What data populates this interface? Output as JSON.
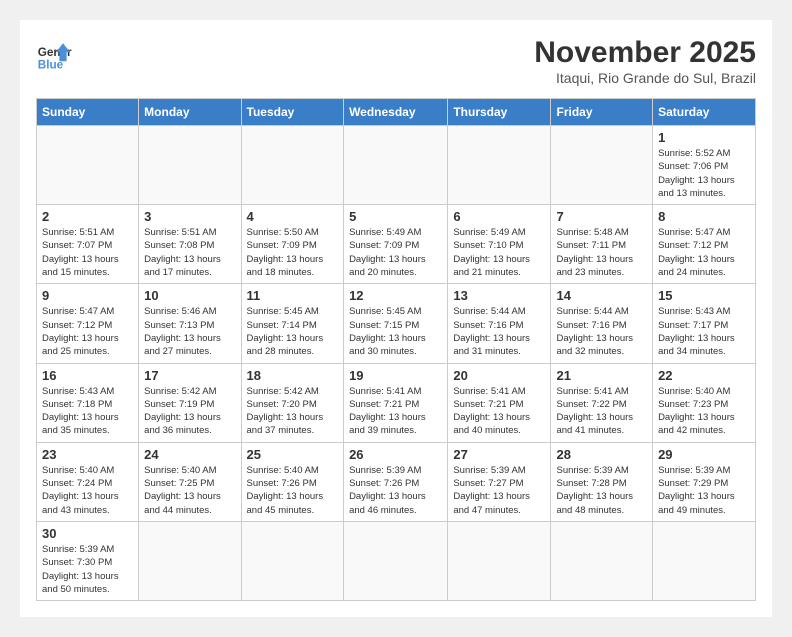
{
  "header": {
    "logo_general": "General",
    "logo_blue": "Blue",
    "month_title": "November 2025",
    "location": "Itaqui, Rio Grande do Sul, Brazil"
  },
  "weekdays": [
    "Sunday",
    "Monday",
    "Tuesday",
    "Wednesday",
    "Thursday",
    "Friday",
    "Saturday"
  ],
  "days": {
    "1": {
      "sunrise": "5:52 AM",
      "sunset": "7:06 PM",
      "daylight": "13 hours and 13 minutes."
    },
    "2": {
      "sunrise": "5:51 AM",
      "sunset": "7:07 PM",
      "daylight": "13 hours and 15 minutes."
    },
    "3": {
      "sunrise": "5:51 AM",
      "sunset": "7:08 PM",
      "daylight": "13 hours and 17 minutes."
    },
    "4": {
      "sunrise": "5:50 AM",
      "sunset": "7:09 PM",
      "daylight": "13 hours and 18 minutes."
    },
    "5": {
      "sunrise": "5:49 AM",
      "sunset": "7:09 PM",
      "daylight": "13 hours and 20 minutes."
    },
    "6": {
      "sunrise": "5:49 AM",
      "sunset": "7:10 PM",
      "daylight": "13 hours and 21 minutes."
    },
    "7": {
      "sunrise": "5:48 AM",
      "sunset": "7:11 PM",
      "daylight": "13 hours and 23 minutes."
    },
    "8": {
      "sunrise": "5:47 AM",
      "sunset": "7:12 PM",
      "daylight": "13 hours and 24 minutes."
    },
    "9": {
      "sunrise": "5:47 AM",
      "sunset": "7:12 PM",
      "daylight": "13 hours and 25 minutes."
    },
    "10": {
      "sunrise": "5:46 AM",
      "sunset": "7:13 PM",
      "daylight": "13 hours and 27 minutes."
    },
    "11": {
      "sunrise": "5:45 AM",
      "sunset": "7:14 PM",
      "daylight": "13 hours and 28 minutes."
    },
    "12": {
      "sunrise": "5:45 AM",
      "sunset": "7:15 PM",
      "daylight": "13 hours and 30 minutes."
    },
    "13": {
      "sunrise": "5:44 AM",
      "sunset": "7:16 PM",
      "daylight": "13 hours and 31 minutes."
    },
    "14": {
      "sunrise": "5:44 AM",
      "sunset": "7:16 PM",
      "daylight": "13 hours and 32 minutes."
    },
    "15": {
      "sunrise": "5:43 AM",
      "sunset": "7:17 PM",
      "daylight": "13 hours and 34 minutes."
    },
    "16": {
      "sunrise": "5:43 AM",
      "sunset": "7:18 PM",
      "daylight": "13 hours and 35 minutes."
    },
    "17": {
      "sunrise": "5:42 AM",
      "sunset": "7:19 PM",
      "daylight": "13 hours and 36 minutes."
    },
    "18": {
      "sunrise": "5:42 AM",
      "sunset": "7:20 PM",
      "daylight": "13 hours and 37 minutes."
    },
    "19": {
      "sunrise": "5:41 AM",
      "sunset": "7:21 PM",
      "daylight": "13 hours and 39 minutes."
    },
    "20": {
      "sunrise": "5:41 AM",
      "sunset": "7:21 PM",
      "daylight": "13 hours and 40 minutes."
    },
    "21": {
      "sunrise": "5:41 AM",
      "sunset": "7:22 PM",
      "daylight": "13 hours and 41 minutes."
    },
    "22": {
      "sunrise": "5:40 AM",
      "sunset": "7:23 PM",
      "daylight": "13 hours and 42 minutes."
    },
    "23": {
      "sunrise": "5:40 AM",
      "sunset": "7:24 PM",
      "daylight": "13 hours and 43 minutes."
    },
    "24": {
      "sunrise": "5:40 AM",
      "sunset": "7:25 PM",
      "daylight": "13 hours and 44 minutes."
    },
    "25": {
      "sunrise": "5:40 AM",
      "sunset": "7:26 PM",
      "daylight": "13 hours and 45 minutes."
    },
    "26": {
      "sunrise": "5:39 AM",
      "sunset": "7:26 PM",
      "daylight": "13 hours and 46 minutes."
    },
    "27": {
      "sunrise": "5:39 AM",
      "sunset": "7:27 PM",
      "daylight": "13 hours and 47 minutes."
    },
    "28": {
      "sunrise": "5:39 AM",
      "sunset": "7:28 PM",
      "daylight": "13 hours and 48 minutes."
    },
    "29": {
      "sunrise": "5:39 AM",
      "sunset": "7:29 PM",
      "daylight": "13 hours and 49 minutes."
    },
    "30": {
      "sunrise": "5:39 AM",
      "sunset": "7:30 PM",
      "daylight": "13 hours and 50 minutes."
    }
  }
}
